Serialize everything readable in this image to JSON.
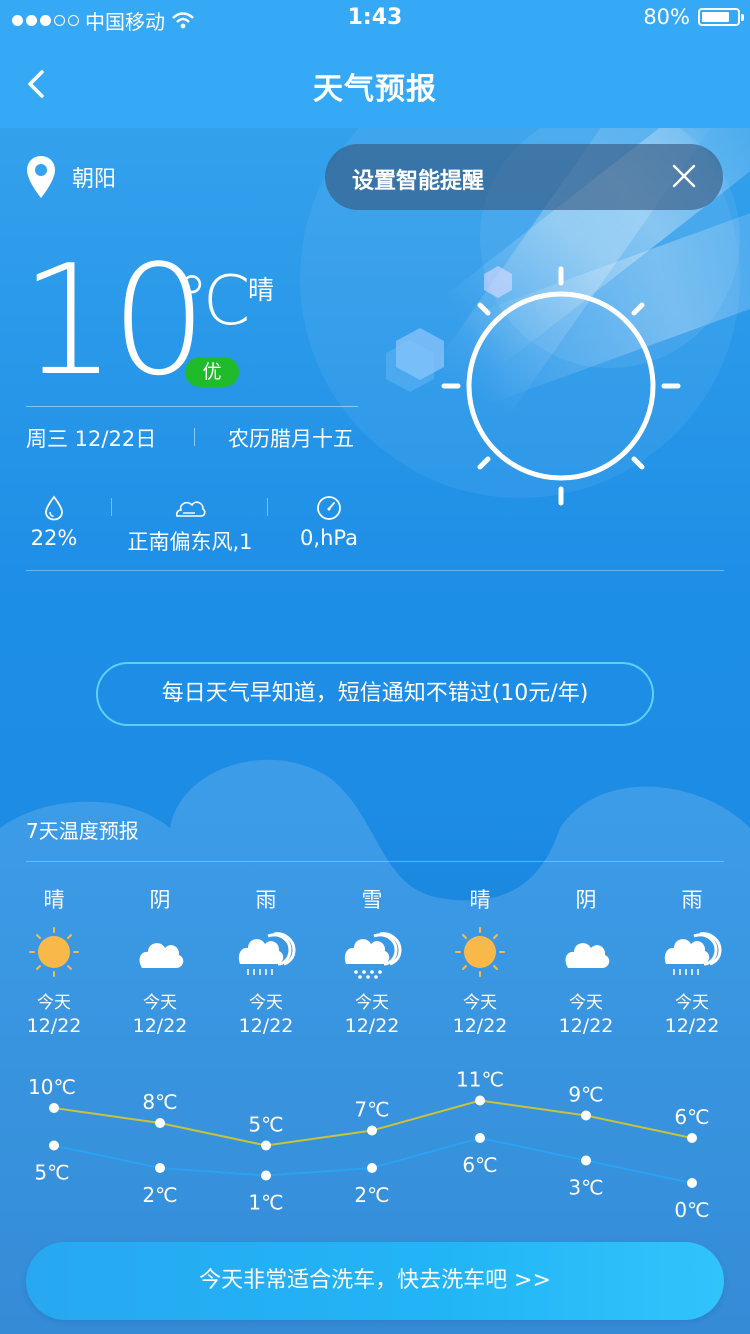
{
  "status_bar": {
    "carrier": "中国移动",
    "time": "1:43",
    "battery": "80%",
    "battery_level": 0.8
  },
  "nav": {
    "title": "天气预报"
  },
  "location": "朝阳",
  "reminder": {
    "label": "设置智能提醒"
  },
  "current": {
    "temp": "10",
    "unit": "℃",
    "condition": "晴",
    "aqi": "优",
    "date": "周三 12/22日",
    "lunar": "农历腊月十五",
    "humidity": "22%",
    "wind": "正南偏东风,1",
    "pressure": "0,hPa"
  },
  "sms_banner": "每日天气早知道，短信通知不错过(10元/年)",
  "forecast_title": "7天温度预报",
  "forecast": [
    {
      "cond": "晴",
      "icon": "sun-icon",
      "label": "今天",
      "date": "12/22",
      "high": "10℃",
      "low": "5℃"
    },
    {
      "cond": "阴",
      "icon": "cloud-icon",
      "label": "今天",
      "date": "12/22",
      "high": "8℃",
      "low": "2℃"
    },
    {
      "cond": "雨",
      "icon": "rain-icon",
      "label": "今天",
      "date": "12/22",
      "high": "5℃",
      "low": "1℃"
    },
    {
      "cond": "雪",
      "icon": "snow-icon",
      "label": "今天",
      "date": "12/22",
      "high": "7℃",
      "low": "2℃"
    },
    {
      "cond": "晴",
      "icon": "sun-icon",
      "label": "今天",
      "date": "12/22",
      "high": "11℃",
      "low": "6℃"
    },
    {
      "cond": "阴",
      "icon": "cloud-icon",
      "label": "今天",
      "date": "12/22",
      "high": "9℃",
      "low": "3℃"
    },
    {
      "cond": "雨",
      "icon": "rain-icon",
      "label": "今天",
      "date": "12/22",
      "high": "6℃",
      "low": "0℃"
    }
  ],
  "chart_data": {
    "type": "line",
    "x": [
      "12/22",
      "12/22",
      "12/22",
      "12/22",
      "12/22",
      "12/22",
      "12/22"
    ],
    "series": [
      {
        "values": [
          10,
          8,
          5,
          7,
          11,
          9,
          6
        ],
        "color": "#c9c33a"
      },
      {
        "values": [
          5,
          2,
          1,
          2,
          6,
          3,
          0
        ],
        "color": "#2aa3f2"
      }
    ]
  },
  "car_wash": "今天非常适合洗车，快去洗车吧 >>",
  "colors": {
    "header": "#36a9f6",
    "aqi_good": "#1fbb2a",
    "sun": "#f9b84a"
  }
}
